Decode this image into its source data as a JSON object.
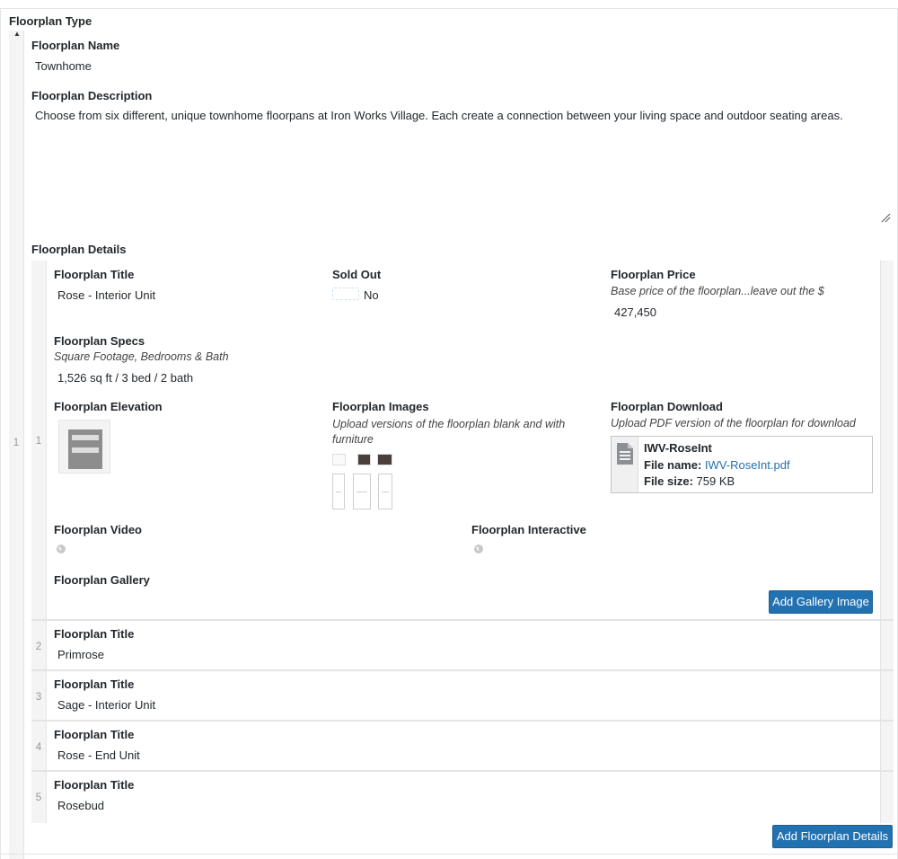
{
  "section": {
    "title": "Floorplan Type"
  },
  "floorplan_name": {
    "label": "Floorplan Name",
    "value": "Townhome"
  },
  "floorplan_description": {
    "label": "Floorplan Description",
    "value": "Choose from six different, unique townhome floorpans at Iron Works Village. Each create a connection between your living space and outdoor seating areas."
  },
  "details": {
    "label": "Floorplan Details",
    "outer_index": "1",
    "rows": [
      {
        "index": "1",
        "title_label": "Floorplan Title",
        "title_value": "Rose - Interior Unit",
        "sold_out_label": "Sold Out",
        "sold_out_value": "No",
        "price_label": "Floorplan Price",
        "price_hint": "Base price of the floorplan...leave out the $",
        "price_value": "427,450",
        "specs_label": "Floorplan Specs",
        "specs_hint": "Square Footage, Bedrooms & Bath",
        "specs_value": "1,526 sq ft / 3 bed / 2 bath",
        "elevation_label": "Floorplan Elevation",
        "images_label": "Floorplan Images",
        "images_hint": "Upload versions of the floorplan blank and with furniture",
        "download_label": "Floorplan Download",
        "download_hint": "Upload PDF version of the floorplan for download",
        "download_file": {
          "title": "IWV-RoseInt",
          "file_name_label": "File name:",
          "file_name": "IWV-RoseInt.pdf",
          "file_size_label": "File size:",
          "file_size": "759 KB"
        },
        "video_label": "Floorplan Video",
        "interactive_label": "Floorplan Interactive",
        "gallery_label": "Floorplan Gallery",
        "add_gallery_button": "Add Gallery Image"
      },
      {
        "index": "2",
        "title_label": "Floorplan Title",
        "title_value": "Primrose"
      },
      {
        "index": "3",
        "title_label": "Floorplan Title",
        "title_value": "Sage - Interior Unit"
      },
      {
        "index": "4",
        "title_label": "Floorplan Title",
        "title_value": "Rose - End Unit"
      },
      {
        "index": "5",
        "title_label": "Floorplan Title",
        "title_value": "Rosebud"
      }
    ],
    "add_button": "Add Floorplan Details"
  },
  "colors": {
    "accent": "#2271b1",
    "gutter": "#f4f4f4",
    "border": "#e4e4e4"
  },
  "icons": [
    "collapse-arrow-icon",
    "document-icon",
    "globe-icon",
    "resize-handle-icon"
  ]
}
